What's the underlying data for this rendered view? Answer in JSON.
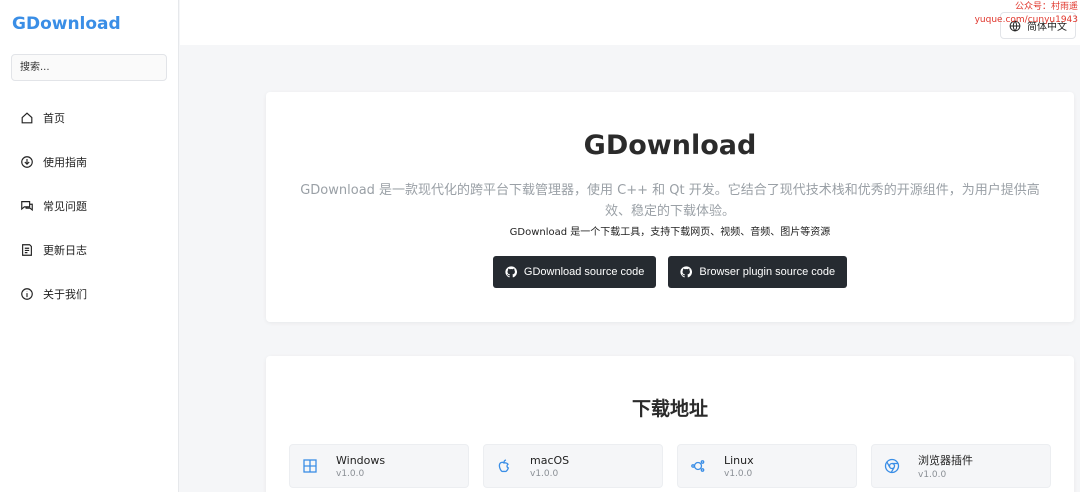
{
  "sidebar": {
    "logo": "GDownload",
    "search_placeholder": "搜索...",
    "items": [
      {
        "label": "首页",
        "icon": "home-icon"
      },
      {
        "label": "使用指南",
        "icon": "download-circle-icon"
      },
      {
        "label": "常见问题",
        "icon": "chat-icon"
      },
      {
        "label": "更新日志",
        "icon": "document-icon"
      },
      {
        "label": "关于我们",
        "icon": "info-icon"
      }
    ]
  },
  "topbar": {
    "lang_label": "简体中文",
    "lang_icon": "globe-icon",
    "watermark_line1": "公众号：村雨遥",
    "watermark_line2": "yuque.com/cunyu1943"
  },
  "hero": {
    "title": "GDownload",
    "description": "GDownload 是一款现代化的跨平台下载管理器，使用 C++ 和 Qt 开发。它结合了现代技术栈和优秀的开源组件，为用户提供高效、稳定的下载体验。",
    "subtitle": "GDownload 是一个下载工具，支持下载网页、视频、音频、图片等资源",
    "buttons": [
      {
        "label": "GDownload source code",
        "icon": "github-icon"
      },
      {
        "label": "Browser plugin source code",
        "icon": "github-icon"
      }
    ]
  },
  "downloads": {
    "title": "下载地址",
    "items": [
      {
        "name": "Windows",
        "version": "v1.0.0",
        "icon": "windows-icon"
      },
      {
        "name": "macOS",
        "version": "v1.0.0",
        "icon": "apple-icon"
      },
      {
        "name": "Linux",
        "version": "v1.0.0",
        "icon": "linux-icon"
      },
      {
        "name": "浏览器插件",
        "version": "v1.0.0",
        "icon": "chrome-icon"
      }
    ]
  },
  "colors": {
    "accent": "#3a8ee6",
    "button_dark": "#262b31",
    "watermark": "#e0352b",
    "icon_blue": "#3a8ee6"
  }
}
